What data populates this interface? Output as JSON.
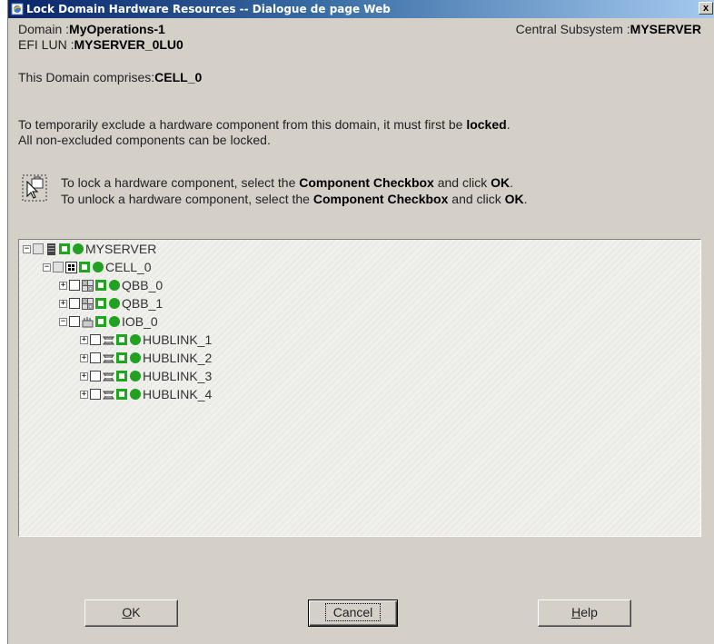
{
  "window": {
    "title": "Lock Domain Hardware Resources -- Dialogue de page Web",
    "close_glyph": "x"
  },
  "info": {
    "domain_label": "Domain :",
    "domain_value": "MyOperations-1",
    "efi_label": "EFI LUN :",
    "efi_value": "MYSERVER_0LU0",
    "subsystem_label": "Central Subsystem :",
    "subsystem_value": "MYSERVER",
    "comprises_label": "This Domain comprises:",
    "comprises_value": "CELL_0"
  },
  "instructions": {
    "line1_pre": "To temporarily exclude a hardware component from this domain, it must first be ",
    "line1_bold": "locked",
    "line1_post": ".",
    "line2": "All non-excluded components can be locked.",
    "lock_pre": "To lock a hardware component, select the ",
    "lock_bold": "Component Checkbox",
    "lock_mid": " and click ",
    "lock_ok": "OK",
    "lock_post": ".",
    "unlock_pre": "To unlock a hardware component, select the ",
    "unlock_bold": "Component Checkbox",
    "unlock_mid": " and click ",
    "unlock_ok": "OK",
    "unlock_post": "."
  },
  "tree": {
    "nodes": [
      {
        "label": "MYSERVER",
        "expander": "−",
        "icon": "server-icon"
      },
      {
        "label": "CELL_0",
        "expander": "−",
        "icon": "cell-icon"
      },
      {
        "label": "QBB_0",
        "expander": "+",
        "icon": "qbb-icon"
      },
      {
        "label": "QBB_1",
        "expander": "+",
        "icon": "qbb-icon"
      },
      {
        "label": "IOB_0",
        "expander": "−",
        "icon": "iob-icon"
      },
      {
        "label": "HUBLINK_1",
        "expander": "+",
        "icon": "hublink-icon"
      },
      {
        "label": "HUBLINK_2",
        "expander": "+",
        "icon": "hublink-icon"
      },
      {
        "label": "HUBLINK_3",
        "expander": "+",
        "icon": "hublink-icon"
      },
      {
        "label": "HUBLINK_4",
        "expander": "+",
        "icon": "hublink-icon"
      }
    ],
    "status_color": "#22a022"
  },
  "buttons": {
    "ok_mnemonic": "O",
    "ok_rest": "K",
    "cancel": "Cancel",
    "help_mnemonic": "H",
    "help_rest": "elp"
  }
}
